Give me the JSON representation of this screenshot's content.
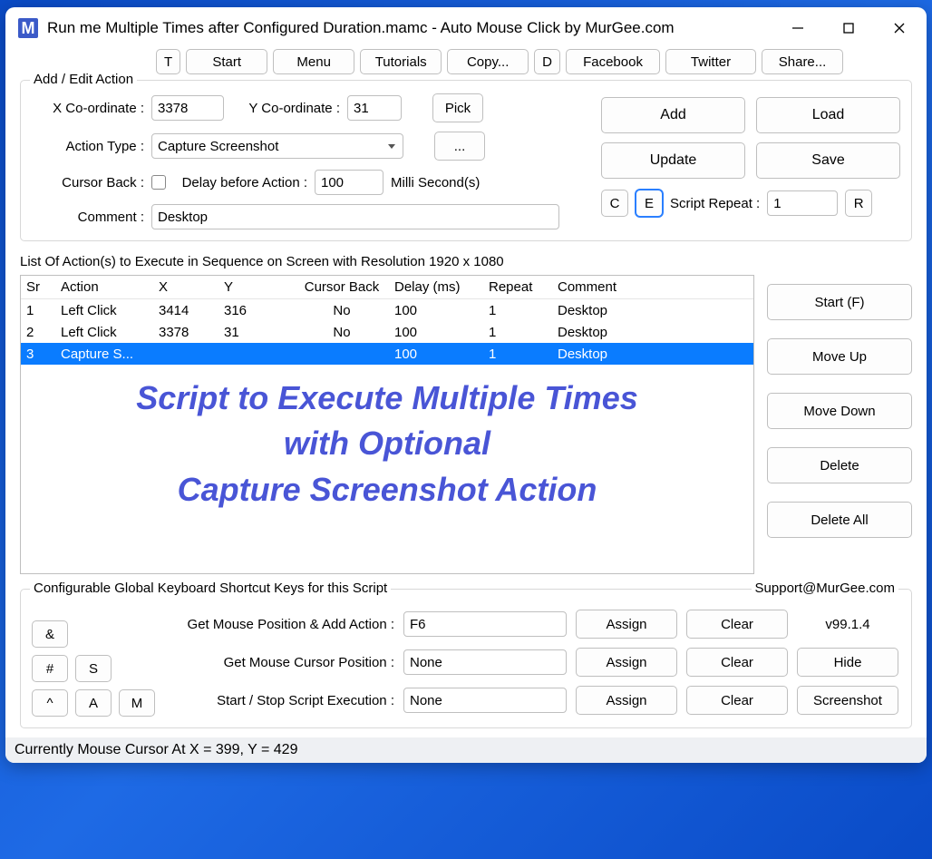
{
  "window": {
    "icon_letter": "M",
    "title": "Run me Multiple Times after Configured Duration.mamc - Auto Mouse Click by MurGee.com"
  },
  "toolbar": {
    "t": "T",
    "start": "Start",
    "menu": "Menu",
    "tutorials": "Tutorials",
    "copy": "Copy...",
    "d": "D",
    "facebook": "Facebook",
    "twitter": "Twitter",
    "share": "Share..."
  },
  "edit": {
    "group_label": "Add / Edit Action",
    "x_label": "X Co-ordinate :",
    "x_value": "3378",
    "y_label": "Y Co-ordinate :",
    "y_value": "31",
    "pick": "Pick",
    "action_type_label": "Action Type :",
    "action_type_value": "Capture Screenshot",
    "dots": "...",
    "cursor_back_label": "Cursor Back :",
    "delay_label": "Delay before Action :",
    "delay_value": "100",
    "delay_unit": "Milli Second(s)",
    "comment_label": "Comment :",
    "comment_value": "Desktop",
    "c": "C",
    "e": "E",
    "script_repeat_label": "Script Repeat :",
    "script_repeat_value": "1",
    "r": "R",
    "add": "Add",
    "load": "Load",
    "update": "Update",
    "save": "Save"
  },
  "list": {
    "label": "List Of Action(s) to Execute in Sequence on Screen with Resolution 1920 x 1080",
    "headers": {
      "sr": "Sr",
      "action": "Action",
      "x": "X",
      "y": "Y",
      "cb": "Cursor Back",
      "delay": "Delay (ms)",
      "repeat": "Repeat",
      "comment": "Comment"
    },
    "rows": [
      {
        "sr": "1",
        "action": "Left Click",
        "x": "3414",
        "y": "316",
        "cb": "No",
        "delay": "100",
        "repeat": "1",
        "comment": "Desktop",
        "selected": false
      },
      {
        "sr": "2",
        "action": "Left Click",
        "x": "3378",
        "y": "31",
        "cb": "No",
        "delay": "100",
        "repeat": "1",
        "comment": "Desktop",
        "selected": false
      },
      {
        "sr": "3",
        "action": "Capture S...",
        "x": "",
        "y": "",
        "cb": "",
        "delay": "100",
        "repeat": "1",
        "comment": "Desktop",
        "selected": true
      }
    ],
    "overlay_l1": "Script to Execute Multiple Times",
    "overlay_l2": "with Optional",
    "overlay_l3": "Capture Screenshot Action",
    "side": {
      "start": "Start (F)",
      "move_up": "Move Up",
      "move_down": "Move Down",
      "delete": "Delete",
      "delete_all": "Delete All"
    }
  },
  "shortcuts": {
    "group_label": "Configurable Global Keyboard Shortcut Keys for this Script",
    "support": "Support@MurGee.com",
    "row1_label": "Get Mouse Position & Add Action :",
    "row1_value": "F6",
    "row2_label": "Get Mouse Cursor Position :",
    "row2_value": "None",
    "row3_label": "Start / Stop Script Execution :",
    "row3_value": "None",
    "assign": "Assign",
    "clear": "Clear",
    "version": "v99.1.4",
    "hide": "Hide",
    "screenshot": "Screenshot",
    "tiny": {
      "amp": "&",
      "hash": "#",
      "s": "S",
      "caret": "^",
      "a": "A",
      "m": "M"
    }
  },
  "status": "Currently Mouse Cursor At X = 399, Y = 429"
}
